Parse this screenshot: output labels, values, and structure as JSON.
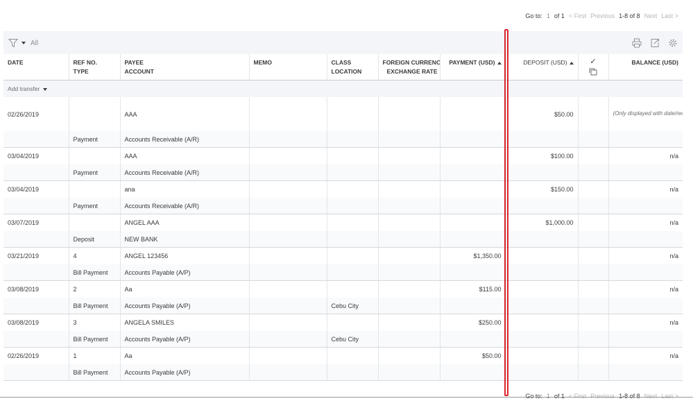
{
  "pager": {
    "goto_label": "Go to:",
    "page_value": "1",
    "of_label": "of 1",
    "first": "< First",
    "previous": "Previous",
    "range": "1-8 of 8",
    "next": "Next",
    "last": "Last >"
  },
  "filter": {
    "label": "All",
    "icon": "filter-icon",
    "tools": [
      "print-icon",
      "export-icon",
      "gear-icon"
    ]
  },
  "columns": {
    "date": "DATE",
    "ref_no": "REF NO.",
    "type": "TYPE",
    "payee": "PAYEE",
    "account": "ACCOUNT",
    "memo": "MEMO",
    "class": "CLASS",
    "location": "LOCATION",
    "foreign_currency": "FOREIGN CURRENCY",
    "exchange_rate": "EXCHANGE RATE",
    "payment": "PAYMENT (USD)",
    "deposit": "DEPOSIT (USD)",
    "check": "✓",
    "balance": "BALANCE (USD)"
  },
  "add_transfer_label": "Add transfer",
  "rows": [
    {
      "date": "02/26/2019",
      "ref": "",
      "payee": "AAA",
      "memo": "",
      "class": "",
      "currency": "",
      "payment": "",
      "deposit": "$50.00",
      "balance": "(Only displayed with date/reconcile status sort)",
      "type": "Payment",
      "account": "Accounts Receivable (A/R)",
      "location": ""
    },
    {
      "date": "03/04/2019",
      "ref": "",
      "payee": "AAA",
      "memo": "",
      "class": "",
      "currency": "",
      "payment": "",
      "deposit": "$100.00",
      "balance": "n/a",
      "type": "Payment",
      "account": "Accounts Receivable (A/R)",
      "location": ""
    },
    {
      "date": "03/04/2019",
      "ref": "",
      "payee": "ana",
      "memo": "",
      "class": "",
      "currency": "",
      "payment": "",
      "deposit": "$150.00",
      "balance": "n/a",
      "type": "Payment",
      "account": "Accounts Receivable (A/R)",
      "location": ""
    },
    {
      "date": "03/07/2019",
      "ref": "",
      "payee": "ANGEL AAA",
      "memo": "",
      "class": "",
      "currency": "",
      "payment": "",
      "deposit": "$1,000.00",
      "balance": "n/a",
      "type": "Deposit",
      "account": "NEW BANK",
      "location": ""
    },
    {
      "date": "03/21/2019",
      "ref": "4",
      "payee": "ANGEL 123456",
      "memo": "",
      "class": "",
      "currency": "",
      "payment": "$1,350.00",
      "deposit": "",
      "balance": "n/a",
      "type": "Bill Payment",
      "account": "Accounts Payable (A/P)",
      "location": ""
    },
    {
      "date": "03/08/2019",
      "ref": "2",
      "payee": "Aa",
      "memo": "",
      "class": "",
      "currency": "",
      "payment": "$115.00",
      "deposit": "",
      "balance": "n/a",
      "type": "Bill Payment",
      "account": "Accounts Payable (A/P)",
      "location": "Cebu City"
    },
    {
      "date": "03/08/2019",
      "ref": "3",
      "payee": "ANGELA SMILES",
      "memo": "",
      "class": "",
      "currency": "",
      "payment": "$250.00",
      "deposit": "",
      "balance": "n/a",
      "type": "Bill Payment",
      "account": "Accounts Payable (A/P)",
      "location": "Cebu City"
    },
    {
      "date": "02/26/2019",
      "ref": "1",
      "payee": "Aa",
      "memo": "",
      "class": "",
      "currency": "",
      "payment": "$50.00",
      "deposit": "",
      "balance": "n/a",
      "type": "Bill Payment",
      "account": "Accounts Payable (A/P)",
      "location": ""
    }
  ],
  "colors": {
    "highlight_border": "#d9272e",
    "filter_bar_bg": "#f4f5f8",
    "text": "#393a3d"
  }
}
